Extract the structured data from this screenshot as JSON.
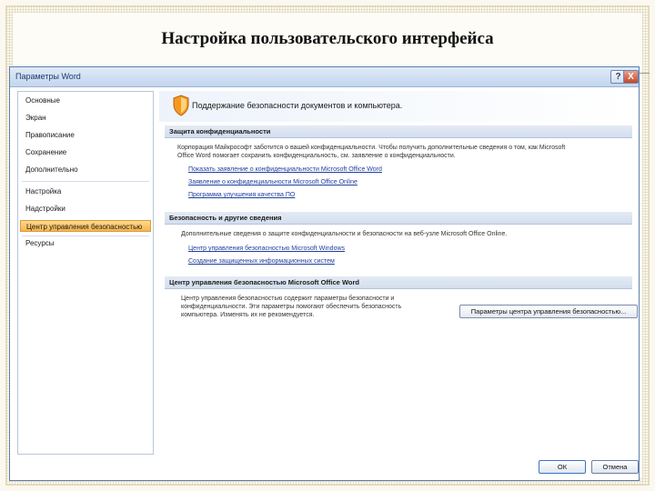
{
  "slide": {
    "title": "Настройка пользовательского интерфейса"
  },
  "dialog": {
    "title": "Параметры Word",
    "help_glyph": "?",
    "close_glyph": "X",
    "sidebar": {
      "items": [
        {
          "label": "Основные"
        },
        {
          "label": "Экран"
        },
        {
          "label": "Правописание"
        },
        {
          "label": "Сохранение"
        },
        {
          "label": "Дополнительно"
        },
        {
          "label": "Настройка"
        },
        {
          "label": "Надстройки"
        },
        {
          "label": "Центр управления безопасностью",
          "selected": true
        },
        {
          "label": "Ресурсы"
        }
      ]
    },
    "banner": {
      "text": "Поддержание безопасности документов и компьютера."
    },
    "sections": {
      "privacy": {
        "heading": "Защита конфиденциальности",
        "description_line1": "Корпорация Майкрософт заботится о вашей конфиденциальности. Чтобы получить дополнительные сведения о том, как Microsoft",
        "description_line2": "Office Word помогает сохранить конфиденциальность, см. заявление о конфиденциальности.",
        "links": [
          "Показать заявление о конфиденциальности Microsoft Office Word",
          "Заявление о конфиденциальности Microsoft Office Online",
          "Программа улучшения качества ПО"
        ]
      },
      "security": {
        "heading": "Безопасность и другие сведения",
        "description": "Дополнительные сведения о защите конфиденциальности и безопасности на веб-узле Microsoft Office Online.",
        "links": [
          "Центр управления безопасностью Microsoft Windows",
          "Создание защищенных информационных систем"
        ]
      },
      "trust_center": {
        "heading": "Центр управления безопасностью Microsoft Office Word",
        "description_line1": "Центр управления безопасностью содержит параметры безопасности и",
        "description_line2": "конфиденциальности. Эти параметры помогают обеспечить безопасность",
        "description_line3": "компьютера. Изменять их не рекомендуется.",
        "button_label": "Параметры центра управления безопасностью..."
      }
    },
    "footer": {
      "ok_label": "ОК",
      "cancel_label": "Отмена"
    }
  },
  "colors": {
    "accent": "#f7b44d",
    "link": "#1f3f9c",
    "titlebar": "#c3d6ee"
  }
}
